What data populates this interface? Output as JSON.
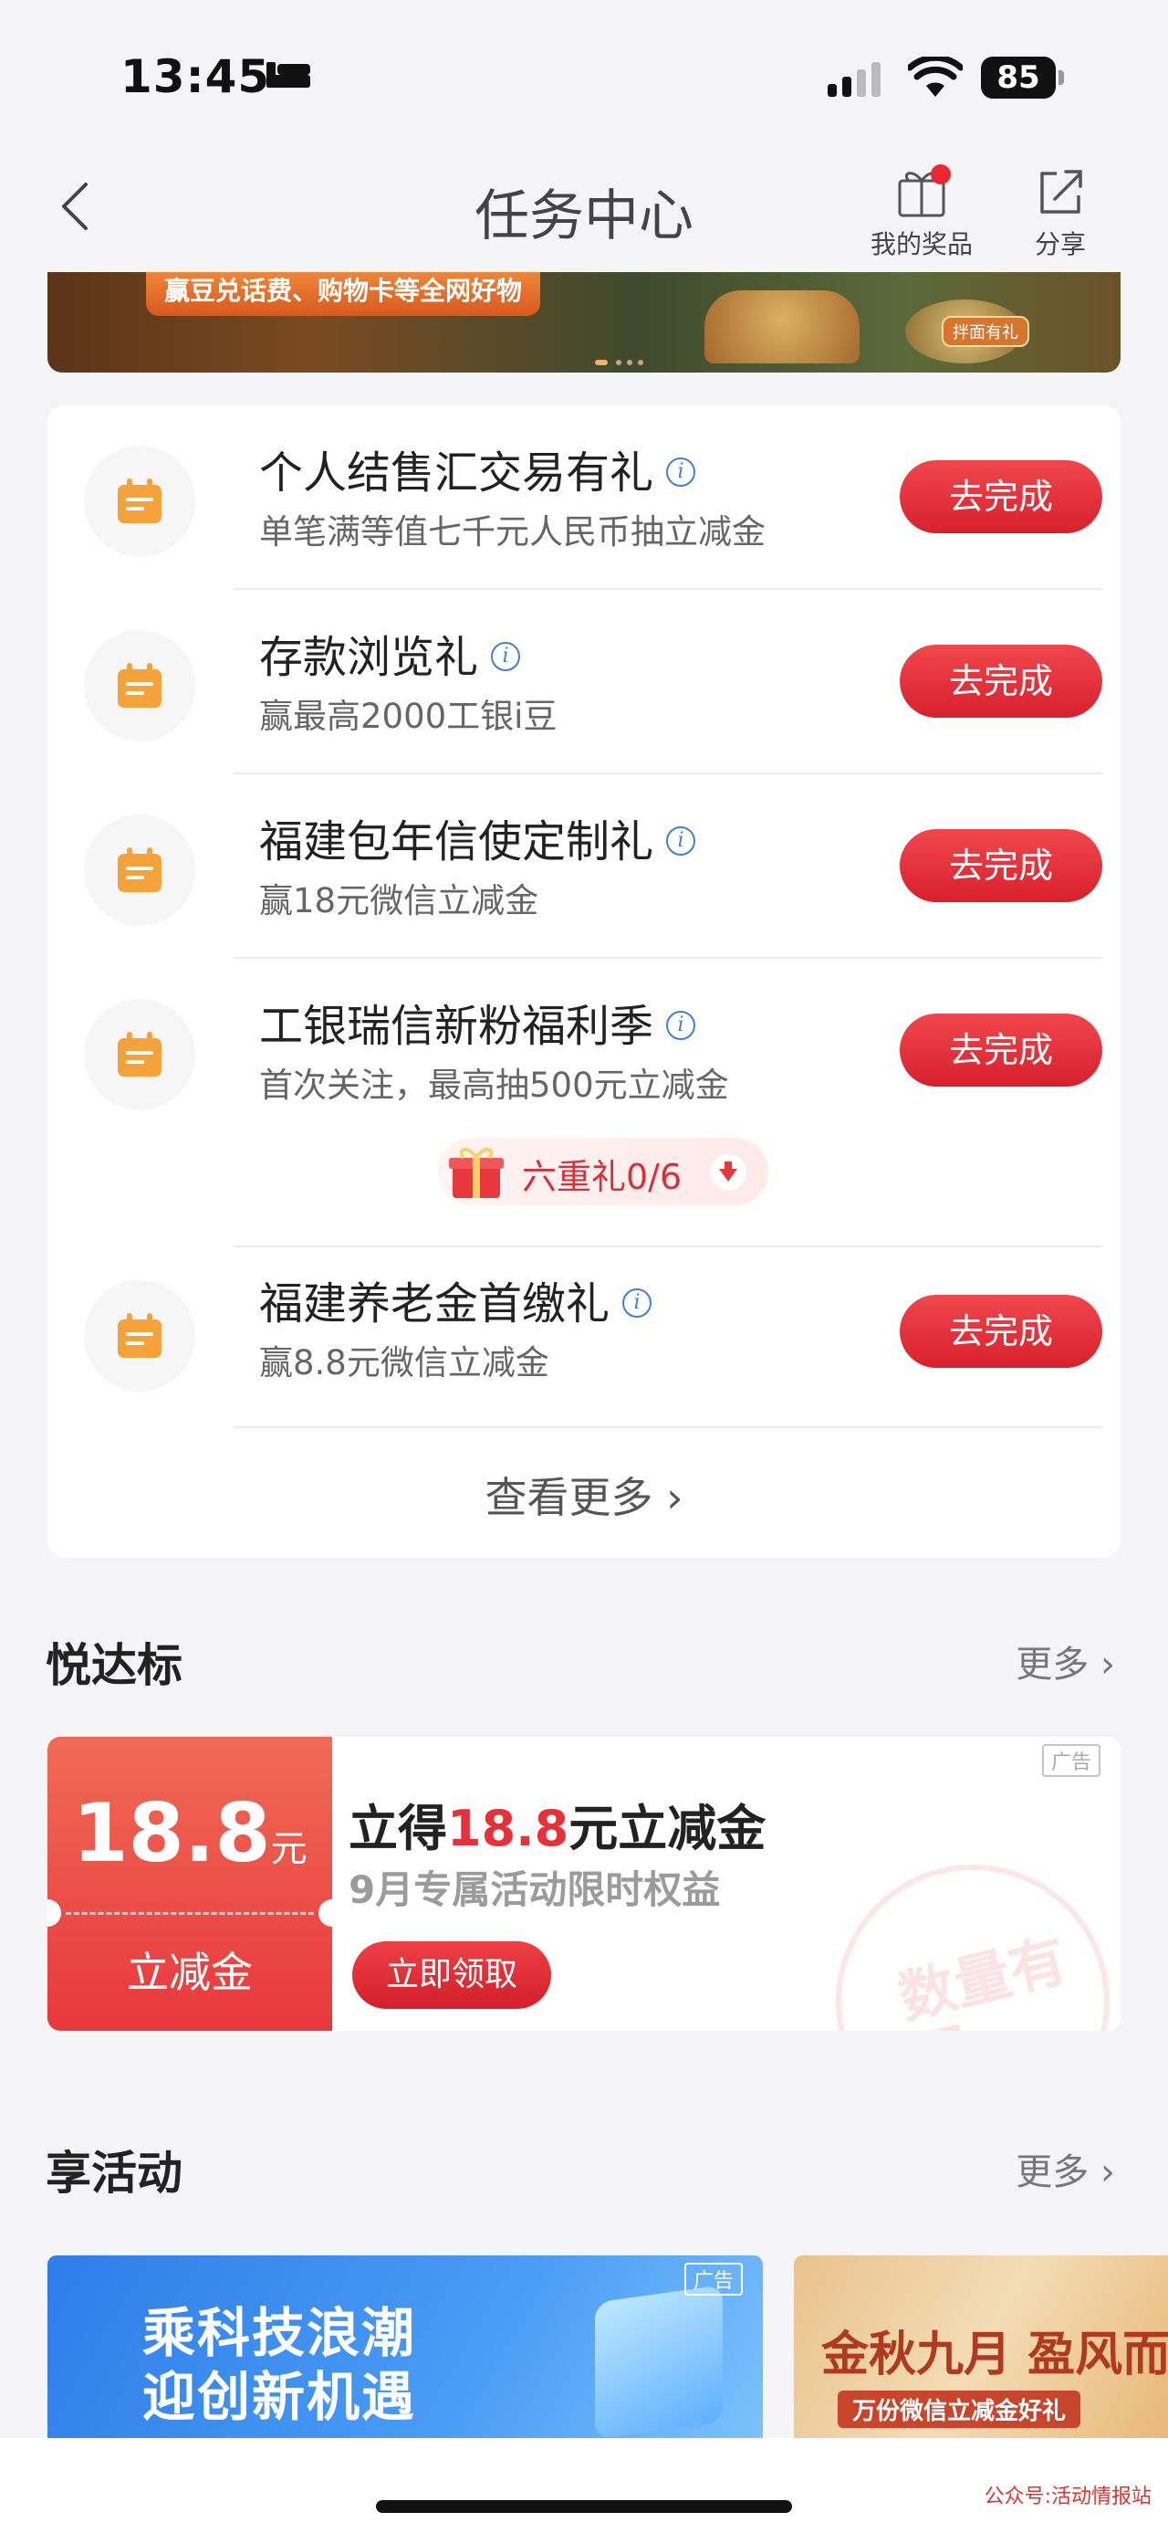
{
  "status_bar": {
    "time": "13:45",
    "battery": "85"
  },
  "nav": {
    "title": "任务中心",
    "prizes_label": "我的奖品",
    "share_label": "分享"
  },
  "banner": {
    "text": "赢豆兑话费、购物卡等全网好物",
    "tag": "拌面有礼"
  },
  "tasks": [
    {
      "title": "个人结售汇交易有礼",
      "subtitle": "单笔满等值七千元人民币抽立减金",
      "button": "去完成"
    },
    {
      "title": "存款浏览礼",
      "subtitle": "赢最高2000工银i豆",
      "button": "去完成"
    },
    {
      "title": "福建包年信使定制礼",
      "subtitle": "赢18元微信立减金",
      "button": "去完成"
    },
    {
      "title": "工银瑞信新粉福利季",
      "subtitle": "首次关注，最高抽500元立减金",
      "button": "去完成"
    },
    {
      "title": "福建养老金首缴礼",
      "subtitle": "赢8.8元微信立减金",
      "button": "去完成"
    }
  ],
  "gift_progress": {
    "label": "六重礼0/6"
  },
  "view_more": "查看更多",
  "section_yuedabiao": {
    "title": "悦达标",
    "more": "更多"
  },
  "coupon": {
    "amount": "18.8",
    "unit": "元",
    "type": "立减金",
    "ad_label": "广告",
    "title_prefix": "立得",
    "title_amount": "18.8",
    "title_suffix": "元立减金",
    "subtitle": "9月专属活动限时权益",
    "button": "立即领取",
    "stamp": "数量有限"
  },
  "section_activities": {
    "title": "享活动",
    "more": "更多"
  },
  "activities": [
    {
      "line1": "乘科技浪潮",
      "line2": "迎创新机遇",
      "ad_label": "广告"
    },
    {
      "line1": "金秋九月 盈风而",
      "line2": "万份微信立减金好礼"
    }
  ],
  "watermark": "公众号:活动情报站",
  "colors": {
    "accent_red": "#e8292f",
    "info_blue": "#3d7fd9",
    "icon_orange": "#f5a23a"
  }
}
